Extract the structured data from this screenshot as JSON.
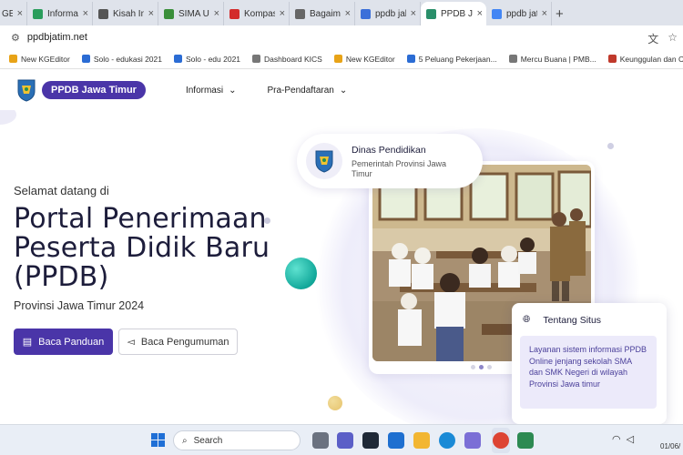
{
  "browser": {
    "tabs": [
      {
        "title": "GE",
        "color": "#888888",
        "active": false
      },
      {
        "title": "Informasi",
        "color": "#2a9d5c",
        "active": false
      },
      {
        "title": "Kisah Insp",
        "color": "#555555",
        "active": false
      },
      {
        "title": "SIMA UN",
        "color": "#3a8f3a",
        "active": false
      },
      {
        "title": "Kompas.c",
        "color": "#d32b2b",
        "active": false
      },
      {
        "title": "Bagaiman",
        "color": "#666666",
        "active": false
      },
      {
        "title": "ppdb jaka",
        "color": "#3b6fd9",
        "active": false
      },
      {
        "title": "PPDB Jaw",
        "color": "#2a8f6a",
        "active": true
      },
      {
        "title": "ppdb jatim",
        "color": "#4285f4",
        "active": false
      }
    ],
    "new_tab": "+",
    "url": "ppdbjatim.net",
    "bookmarks": [
      {
        "label": "New KGEditor",
        "color": "#e8a317"
      },
      {
        "label": "Solo - edukasi 2021",
        "color": "#2b6cd4"
      },
      {
        "label": "Solo - edu 2021",
        "color": "#2b6cd4"
      },
      {
        "label": "Dashboard KICS",
        "color": "#777777"
      },
      {
        "label": "New KGEditor",
        "color": "#e8a317"
      },
      {
        "label": "5 Peluang Pekerjaan...",
        "color": "#2b6cd4"
      },
      {
        "label": "Mercu Buana | PMB...",
        "color": "#777777"
      },
      {
        "label": "Keunggulan dan Ca...",
        "color": "#c0392b"
      }
    ],
    "bookmarks_more": "»"
  },
  "site": {
    "brand": "PPDB Jawa Timur",
    "nav": [
      {
        "label": "Informasi"
      },
      {
        "label": "Pra-Pendaftaran"
      }
    ],
    "hero": {
      "welcome": "Selamat datang di",
      "title_line1": "Portal Penerimaan",
      "title_line2": "Peserta Didik Baru",
      "title_line3": "(PPDB)",
      "subtitle": "Provinsi Jawa Timur 2024",
      "primary_button": "Baca Panduan",
      "secondary_button": "Baca Pengumuman"
    },
    "dinas_card": {
      "title": "Dinas Pendidikan",
      "subtitle": "Pemerintah Provinsi Jawa Timur"
    },
    "tentang_card": {
      "title": "Tentang Situs",
      "body": "Layanan sistem informasi PPDB Online jenjang sekolah SMA dan SMK Negeri di wilayah Provinsi Jawa timur"
    },
    "colors": {
      "primary": "#4a35a8",
      "teal": "#12a89a",
      "gold": "#e6c36d"
    }
  },
  "taskbar": {
    "search_placeholder": "Search",
    "clock_date": "01/06/"
  }
}
